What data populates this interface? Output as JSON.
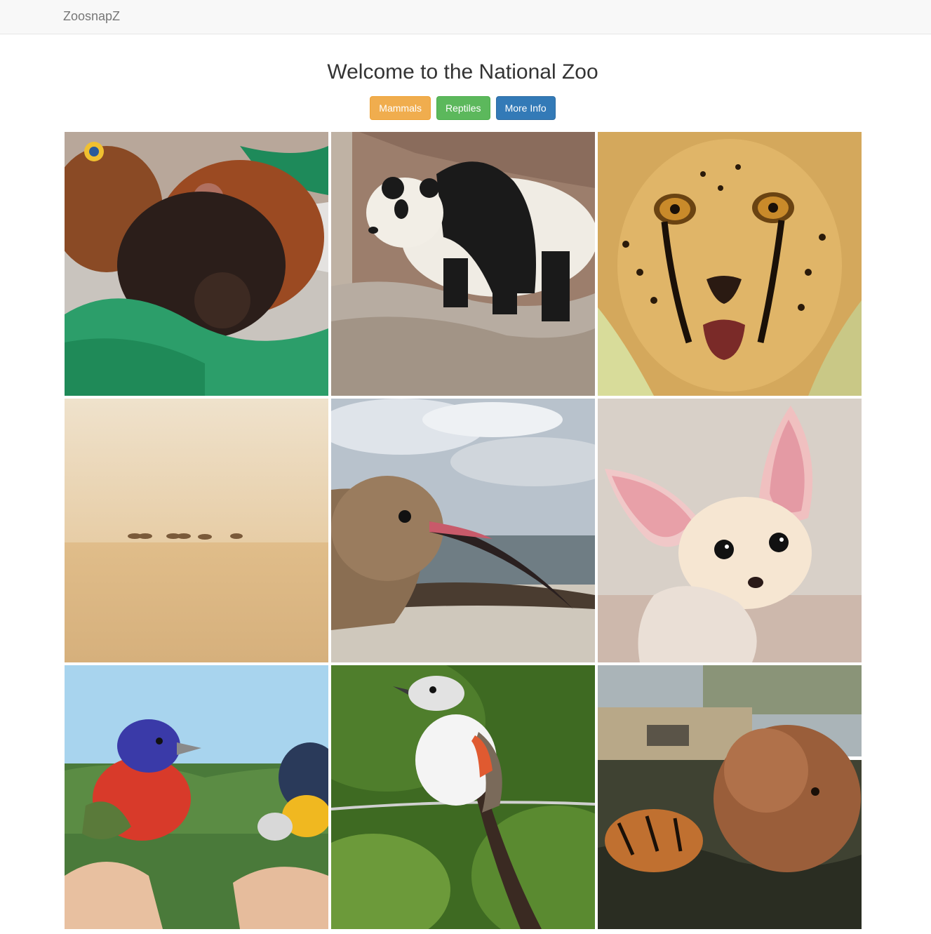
{
  "navbar": {
    "brand": "ZoosnapZ"
  },
  "main": {
    "title": "Welcome to the National Zoo",
    "buttons": [
      {
        "label": "Mammals",
        "color": "#f0ad4e"
      },
      {
        "label": "Reptiles",
        "color": "#5cb85c"
      },
      {
        "label": "More Info",
        "color": "#337ab7"
      }
    ]
  },
  "gallery": {
    "photos": [
      {
        "subject": "baby red panda"
      },
      {
        "subject": "giant panda"
      },
      {
        "subject": "cheetah"
      },
      {
        "subject": "antelope herd in desert"
      },
      {
        "subject": "curlew shorebird"
      },
      {
        "subject": "fennec fox"
      },
      {
        "subject": "painted bunting birds"
      },
      {
        "subject": "scissor-tailed flycatcher"
      },
      {
        "subject": "tiger with ball"
      }
    ]
  }
}
